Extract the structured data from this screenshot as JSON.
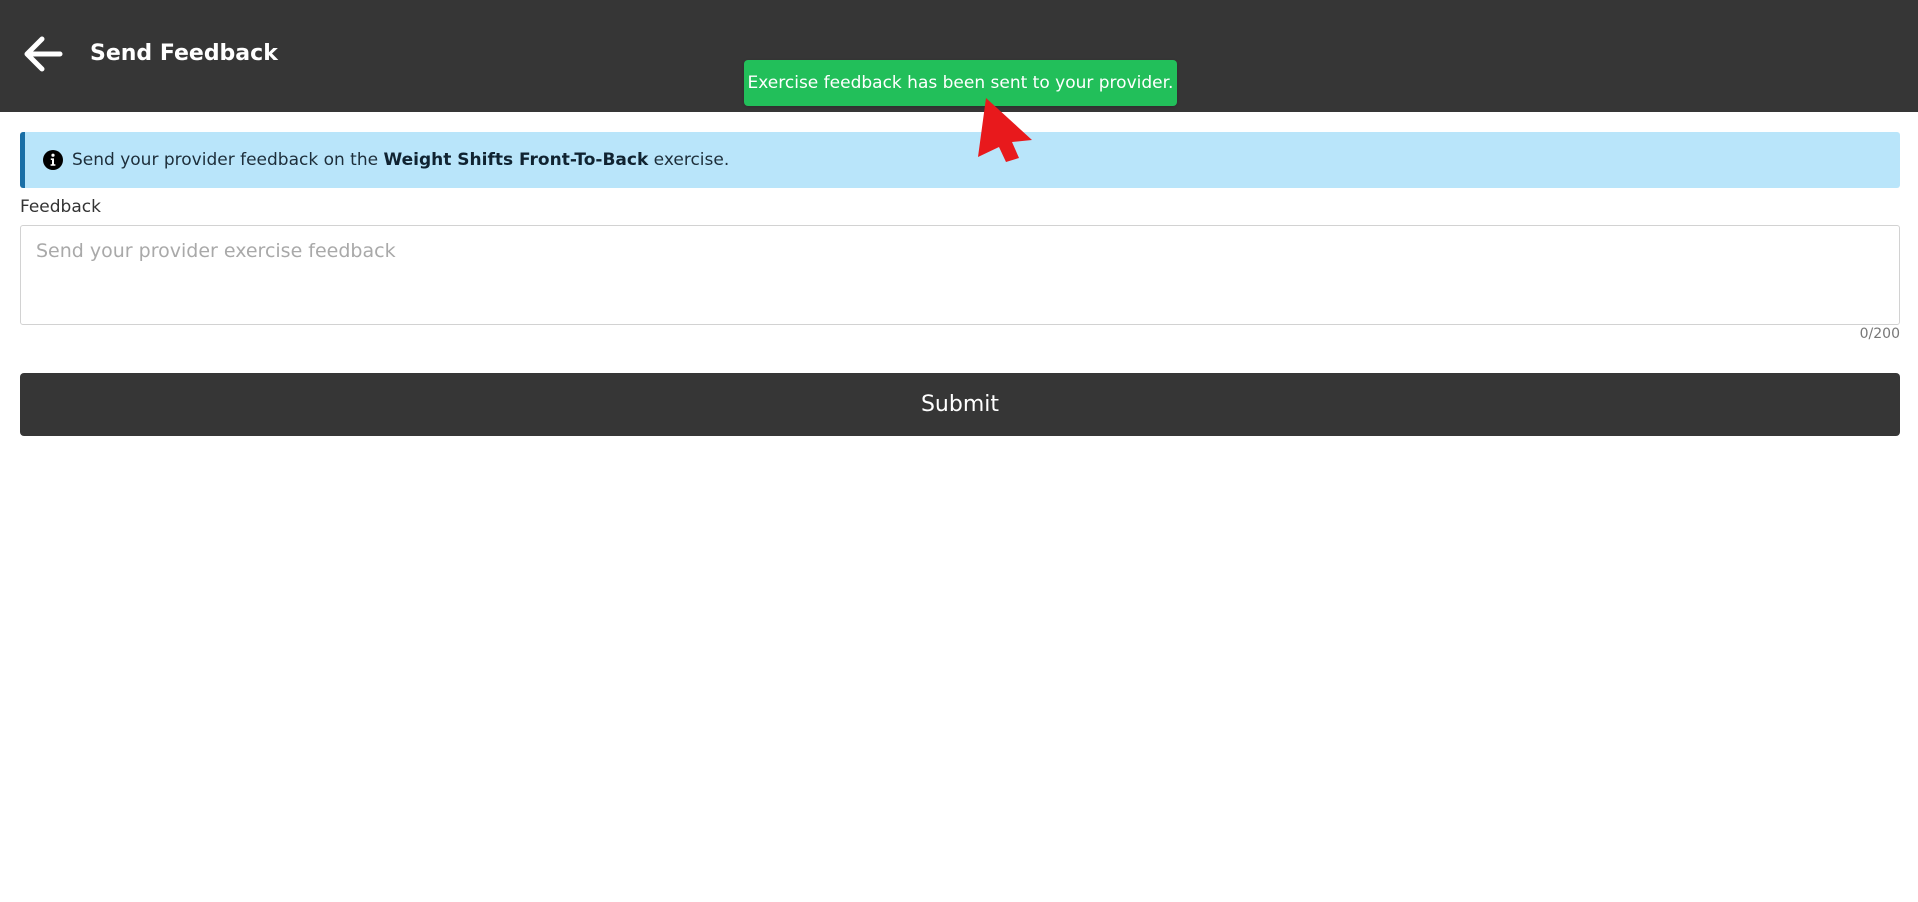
{
  "header": {
    "title": "Send Feedback",
    "back_icon": "arrow-left-icon"
  },
  "toast": {
    "message": "Exercise feedback has been sent to your provider.",
    "color": "#22bf5a"
  },
  "alert": {
    "icon": "info-icon",
    "prefix": "Send your provider feedback on the ",
    "exercise_name": "Weight Shifts Front-To-Back",
    "suffix": " exercise."
  },
  "form": {
    "label": "Feedback",
    "placeholder": "Send your provider exercise feedback",
    "value": "",
    "counter": "0/200"
  },
  "submit_label": "Submit",
  "colors": {
    "header_bg": "#363636",
    "alert_bg": "#b9e5fa",
    "alert_border": "#1a6fa6",
    "button_bg": "#363636",
    "cursor": "#e8191c"
  }
}
